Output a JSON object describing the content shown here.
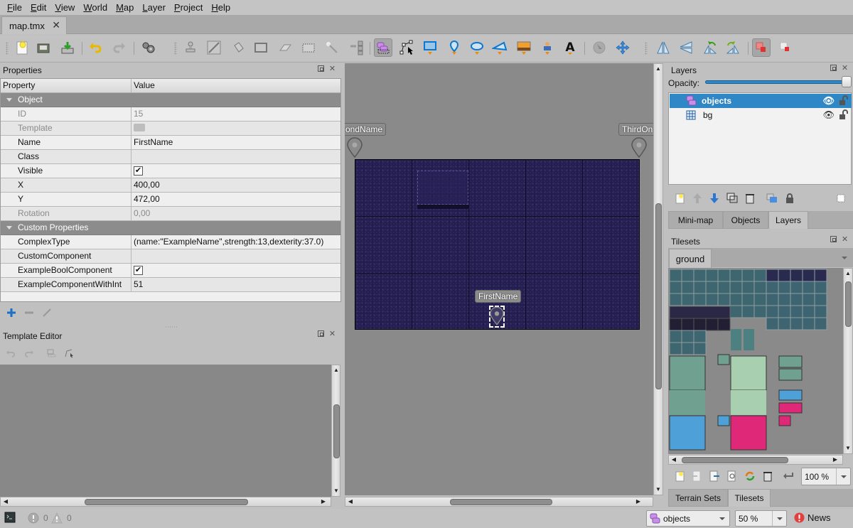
{
  "menu": [
    {
      "u": "F",
      "rest": "ile"
    },
    {
      "u": "E",
      "rest": "dit"
    },
    {
      "u": "V",
      "rest": "iew"
    },
    {
      "u": "W",
      "rest": "orld"
    },
    {
      "u": "M",
      "rest": "ap"
    },
    {
      "u": "L",
      "rest": "ayer"
    },
    {
      "u": "P",
      "rest": "roject"
    },
    {
      "u": "H",
      "rest": "elp"
    }
  ],
  "document_tab": {
    "label": "map.tmx",
    "close": "✕"
  },
  "toolbar": {
    "buttons": [
      "new-file",
      "open-file",
      "save",
      "undo",
      "redo",
      "commands",
      "stamp-brush",
      "terrain-brush",
      "bucket-fill",
      "shape-fill",
      "eraser",
      "rectangle-select",
      "magic-wand",
      "select-same-tile",
      "select-objects",
      "edit-polygons",
      "insert-rectangle",
      "insert-point",
      "insert-ellipse",
      "insert-polygon",
      "insert-tile",
      "insert-template",
      "insert-text",
      "replace-with-template",
      "move-objects",
      "flip-horizontal",
      "flip-vertical",
      "rotate-left",
      "rotate-right",
      "highlight-current-layer",
      "show-tile-collisions"
    ],
    "active": [
      "select-objects",
      "highlight-current-layer"
    ]
  },
  "properties_panel": {
    "title": "Properties",
    "col_property": "Property",
    "col_value": "Value",
    "groups": [
      {
        "name": "Object",
        "rows": [
          {
            "key": "ID",
            "value": "15",
            "disabled": true
          },
          {
            "key": "Template",
            "value": "",
            "disabled": true,
            "type": "template"
          },
          {
            "key": "Name",
            "value": "FirstName"
          },
          {
            "key": "Class",
            "value": ""
          },
          {
            "key": "Visible",
            "value": "✔",
            "type": "checkbox"
          },
          {
            "key": "X",
            "value": "400,00"
          },
          {
            "key": "Y",
            "value": "472,00"
          },
          {
            "key": "Rotation",
            "value": "0,00",
            "disabled": true
          }
        ]
      },
      {
        "name": "Custom Properties",
        "rows": [
          {
            "key": "ComplexType",
            "value": "(name:\"ExampleName\",strength:13,dexterity:37.0)"
          },
          {
            "key": "CustomComponent",
            "value": ""
          },
          {
            "key": "ExampleBoolComponent",
            "value": "✔",
            "type": "checkbox"
          },
          {
            "key": "ExampleComponentWithInt",
            "value": "51"
          }
        ]
      }
    ],
    "actions": [
      "add-property",
      "remove-property",
      "rename-property"
    ]
  },
  "template_editor": {
    "title": "Template Editor"
  },
  "map": {
    "objects": [
      {
        "name": "SecondName",
        "visible_label": "ondName"
      },
      {
        "name": "ThirdOne",
        "visible_label": "ThirdOn"
      },
      {
        "name": "FirstName",
        "visible_label": "FirstName",
        "selected": true
      }
    ],
    "background_color": "#231f4e"
  },
  "layers_panel": {
    "title": "Layers",
    "opacity_label": "Opacity:",
    "opacity": 1.0,
    "layers": [
      {
        "name": "objects",
        "type": "object-layer",
        "selected": true,
        "visible": true,
        "locked": false
      },
      {
        "name": "bg",
        "type": "tile-layer",
        "selected": false,
        "visible": true,
        "locked": false
      }
    ],
    "tabs": [
      {
        "label": "Mini-map"
      },
      {
        "label": "Objects"
      },
      {
        "label": "Layers",
        "active": true
      }
    ]
  },
  "tilesets_panel": {
    "title": "Tilesets",
    "tabs": [
      {
        "label": "ground",
        "active": true
      }
    ],
    "zoom": "100 %",
    "bottom_tabs": [
      {
        "label": "Terrain Sets"
      },
      {
        "label": "Tilesets",
        "active": true
      }
    ]
  },
  "statusbar": {
    "errors": "0",
    "warnings": "0",
    "current_layer": "objects",
    "zoom": "50 %",
    "news": "News"
  },
  "colors": {
    "selection": "#2f87c6",
    "accent_blue": "#1e88d8",
    "object_purple": "#c590e6",
    "news_red": "#e04040"
  }
}
